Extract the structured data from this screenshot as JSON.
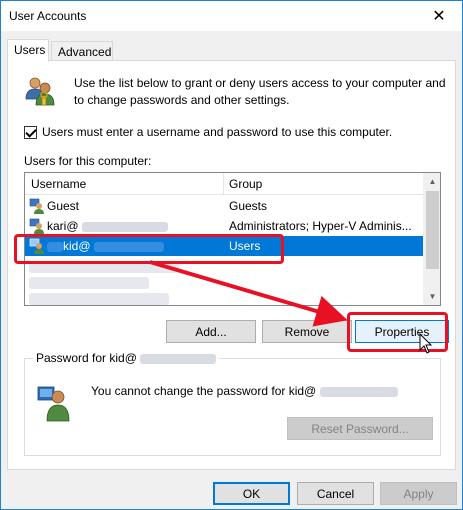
{
  "window": {
    "title": "User Accounts",
    "close_glyph": "✕"
  },
  "tabs": [
    {
      "label": "Users",
      "active": true
    },
    {
      "label": "Advanced",
      "active": false
    }
  ],
  "intro": {
    "text": "Use the list below to grant or deny users access to your computer and to change passwords and other settings.",
    "icon": "users-group-icon"
  },
  "require_login": {
    "label": "Users must enter a username and password to use this computer.",
    "checked": true
  },
  "users_list": {
    "label": "Users for this computer:",
    "columns": [
      "Username",
      "Group"
    ],
    "rows": [
      {
        "username": "Guest",
        "group": "Guests",
        "selected": false
      },
      {
        "username": "kari@",
        "group": "Administrators; Hyper-V Adminis...",
        "selected": false
      },
      {
        "username": "kid@",
        "group": "Users",
        "selected": true
      }
    ],
    "scroll_up_glyph": "▲",
    "scroll_down_glyph": "▼"
  },
  "list_buttons": {
    "add": "Add...",
    "remove": "Remove",
    "properties": "Properties"
  },
  "password_group": {
    "legend": "Password for kid@",
    "message": "You cannot change the password for kid@",
    "reset_label": "Reset Password..."
  },
  "dialog_buttons": {
    "ok": "OK",
    "cancel": "Cancel",
    "apply": "Apply"
  },
  "colors": {
    "selection": "#0078d7",
    "highlight": "#e81123",
    "accent_border": "#1883d7"
  }
}
